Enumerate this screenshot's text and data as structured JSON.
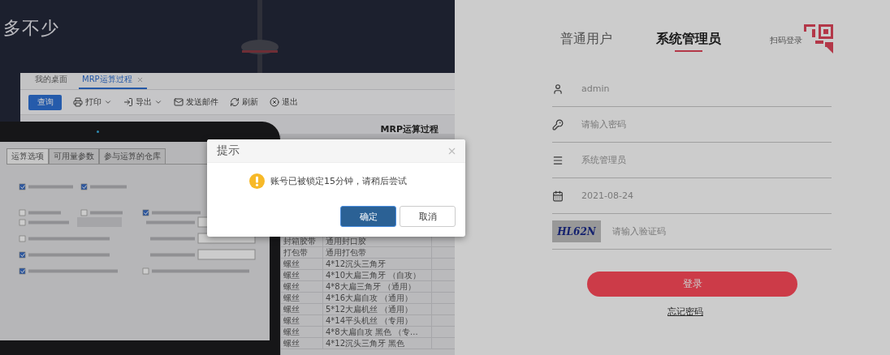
{
  "banner": {
    "slogan": "多不少"
  },
  "app_preview": {
    "tabs": [
      {
        "label": "我的桌面",
        "selected": false,
        "closable": false
      },
      {
        "label": "MRP运算过程",
        "selected": true,
        "closable": true
      }
    ],
    "toolbar": [
      {
        "kind": "query",
        "label": "查询",
        "dropdown": false
      },
      {
        "kind": "print",
        "label": "打印",
        "dropdown": true
      },
      {
        "kind": "export",
        "label": "导出",
        "dropdown": true
      },
      {
        "kind": "mail",
        "label": "发送邮件",
        "dropdown": false
      },
      {
        "kind": "refresh",
        "label": "刷新",
        "dropdown": false
      },
      {
        "kind": "exit",
        "label": "退出",
        "dropdown": false
      }
    ],
    "report_title": "MRP运算过程",
    "option_tabs": [
      {
        "label": "运算选项",
        "selected": true
      },
      {
        "label": "可用量参数",
        "selected": false
      },
      {
        "label": "参与运算的仓库",
        "selected": false
      }
    ],
    "table_rows": [
      [
        "封箱胶带",
        "通用封口胶"
      ],
      [
        "打包带",
        "通用打包带"
      ],
      [
        "螺丝",
        "4*12沉头三角牙"
      ],
      [
        "螺丝",
        "4*10大扁三角牙 （自攻）"
      ],
      [
        "螺丝",
        "4*8大扁三角牙 （通用）"
      ],
      [
        "螺丝",
        "4*16大扁自攻 （通用）"
      ],
      [
        "螺丝",
        "5*12大扁机丝 （通用）"
      ],
      [
        "螺丝",
        "4*14平头机丝 （专用）"
      ],
      [
        "螺丝",
        "4*8大扁自攻 黑色 （专..."
      ],
      [
        "螺丝",
        "4*12沉头三角牙 黑色"
      ]
    ]
  },
  "login": {
    "tabs": [
      {
        "label": "普通用户",
        "selected": false
      },
      {
        "label": "系统管理员",
        "selected": true
      }
    ],
    "qr_login": "扫码登录",
    "fields": [
      {
        "kind": "user",
        "value": "admin"
      },
      {
        "kind": "password",
        "placeholder": "请输入密码"
      },
      {
        "kind": "role",
        "value": "系统管理员"
      },
      {
        "kind": "date",
        "value": "2021-08-24"
      },
      {
        "kind": "captcha",
        "captcha": "HL62N",
        "placeholder": "请输入验证码"
      }
    ],
    "submit": "登录",
    "forgot": "忘记密码"
  },
  "dialog": {
    "title": "提示",
    "message": "账号已被锁定15分钟，请稍后尝试",
    "buttons": [
      {
        "kind": "primary",
        "label": "确定"
      },
      {
        "kind": "default",
        "label": "取消"
      }
    ]
  }
}
